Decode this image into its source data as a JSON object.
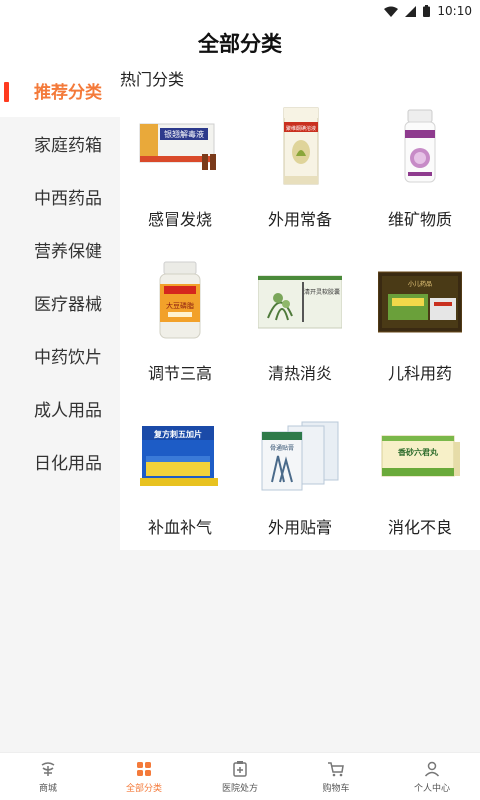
{
  "status_bar": {
    "time": "10:10",
    "icons": [
      "wifi-icon",
      "signal-icon",
      "battery-icon"
    ]
  },
  "header": {
    "title": "全部分类"
  },
  "sidebar": {
    "items": [
      {
        "label": "推荐分类",
        "active": true
      },
      {
        "label": "家庭药箱",
        "active": false
      },
      {
        "label": "中西药品",
        "active": false
      },
      {
        "label": "营养保健",
        "active": false
      },
      {
        "label": "医疗器械",
        "active": false
      },
      {
        "label": "中药饮片",
        "active": false
      },
      {
        "label": "成人用品",
        "active": false
      },
      {
        "label": "日化用品",
        "active": false
      }
    ]
  },
  "main": {
    "section_title": "热门分类",
    "categories": [
      {
        "label": "感冒发烧",
        "image": "cold-medicine-box",
        "box_text": "银翘解毒液"
      },
      {
        "label": "外用常备",
        "image": "topical-medicine-box",
        "box_text": "聚维酮碘溶液"
      },
      {
        "label": "维矿物质",
        "image": "vitamin-bottle",
        "box_text": ""
      },
      {
        "label": "调节三高",
        "image": "supplement-bottle",
        "box_text": "大豆磷脂"
      },
      {
        "label": "清热消炎",
        "image": "herbal-capsule-box",
        "box_text": "清开灵软胶囊"
      },
      {
        "label": "儿科用药",
        "image": "pediatric-medicine-box",
        "box_text": "小儿药品"
      },
      {
        "label": "补血补气",
        "image": "tablet-box",
        "box_text": "复方刺五加片"
      },
      {
        "label": "外用贴膏",
        "image": "plaster-box",
        "box_text": "骨通贴膏"
      },
      {
        "label": "消化不良",
        "image": "digestive-pill-box",
        "box_text": "香砂六君丸"
      }
    ]
  },
  "tabbar": {
    "tabs": [
      {
        "label": "商城",
        "icon": "mall-icon",
        "active": false
      },
      {
        "label": "全部分类",
        "icon": "category-grid-icon",
        "active": true
      },
      {
        "label": "医院处方",
        "icon": "prescription-icon",
        "active": false
      },
      {
        "label": "购物车",
        "icon": "cart-icon",
        "active": false
      },
      {
        "label": "个人中心",
        "icon": "profile-icon",
        "active": false
      }
    ]
  },
  "colors": {
    "accent": "#f47a3a",
    "active_marker": "#ff3b1f",
    "background": "#f5f5f5",
    "panel": "#ffffff"
  }
}
